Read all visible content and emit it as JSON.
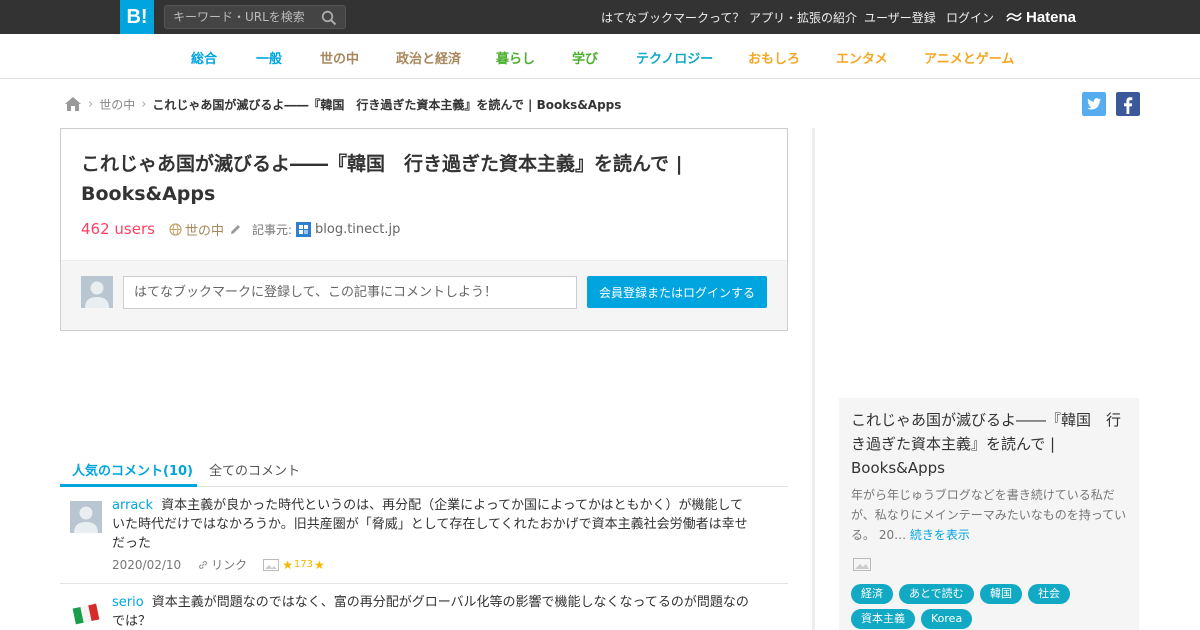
{
  "header": {
    "logo": "B!",
    "search_placeholder": "キーワード・URLを検索",
    "links": [
      "はてなブックマークって？",
      "アプリ・拡張の紹介",
      "ユーザー登録",
      "ログイン"
    ],
    "brand": "Hatena"
  },
  "categories": [
    {
      "label": "総合",
      "color": "#00a4de"
    },
    {
      "label": "一般",
      "color": "#00a4de"
    },
    {
      "label": "世の中",
      "color": "#a8875c"
    },
    {
      "label": "政治と経済",
      "color": "#a8875c"
    },
    {
      "label": "暮らし",
      "color": "#4caf2d"
    },
    {
      "label": "学び",
      "color": "#4caf2d"
    },
    {
      "label": "テクノロジー",
      "color": "#11a9c4"
    },
    {
      "label": "おもしろ",
      "color": "#f5a623"
    },
    {
      "label": "エンタメ",
      "color": "#f5a623"
    },
    {
      "label": "アニメとゲーム",
      "color": "#f5a623"
    }
  ],
  "breadcrumb": {
    "parent": "世の中",
    "current": "これじゃあ国が滅びるよ――『韓国　行き過ぎた資本主義』を読んで | Books&Apps"
  },
  "entry": {
    "title": "これじゃあ国が滅びるよ――『韓国　行き過ぎた資本主義』を読んで | Books&Apps",
    "users": "462 users",
    "category": "世の中",
    "source_label": "記事元:",
    "source": "blog.tinect.jp",
    "comment_placeholder": "はてなブックマークに登録して、この記事にコメントしよう！",
    "login_button": "会員登録またはログインする"
  },
  "tabs": {
    "popular": "人気のコメント(10)",
    "all": "全てのコメント"
  },
  "comments": [
    {
      "user": "arrack",
      "text": "資本主義が良かった時代というのは、再分配（企業によってか国によってかはともかく）が機能していた時代だけではなかろうか。旧共産圏が「脅威」として存在してくれたおかげで資本主義社会労働者は幸せだった",
      "date": "2020/02/10",
      "link_label": "リンク",
      "stars": "173"
    },
    {
      "user": "serio",
      "text": "資本主義が問題なのではなく、富の再分配がグローバル化等の影響で機能しなくなってるのが問題なのでは？"
    }
  ],
  "sidebar": {
    "title": "これじゃあ国が滅びるよ――『韓国　行き過ぎた資本主義』を読んで | Books&Apps",
    "description": "年がら年じゅうブログなどを書き続けている私だが、私なりにメインテーマみたいなものを持っている。 20…",
    "more": "続きを表示",
    "tags": [
      "経済",
      "あとで読む",
      "韓国",
      "社会",
      "資本主義",
      "Korea"
    ]
  },
  "colors": {
    "brand_blue": "#00a4de",
    "users_red": "#ff4166",
    "topbar": "#333333",
    "tag_teal": "#11a9c4"
  }
}
